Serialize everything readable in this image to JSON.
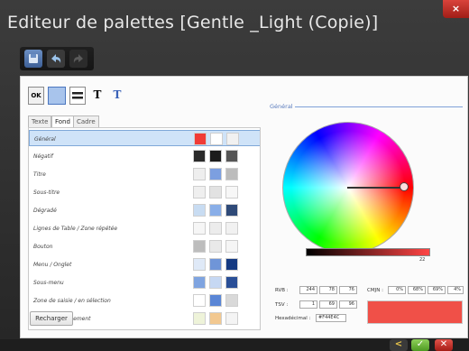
{
  "window": {
    "title": "Editeur de palettes [Gentle _Light (Copie)]",
    "close": "×"
  },
  "toolbar": {
    "icons": [
      "save-icon",
      "undo-icon",
      "redo-icon"
    ]
  },
  "mini_toolbar": {
    "ok": "OK",
    "t1": "T",
    "t2": "T"
  },
  "tabs": [
    "Texte",
    "Fond",
    "Cadre"
  ],
  "active_tab": "Fond",
  "rows": [
    {
      "label": "Général",
      "colors": [
        "#f03b36",
        "#ffffff",
        "#f1f1f1"
      ],
      "selected": true
    },
    {
      "label": "Négatif",
      "colors": [
        "#2a2a2a",
        "#1c1c1c",
        "#555555"
      ]
    },
    {
      "label": "Titre",
      "colors": [
        "#eeeeee",
        "#7c9fe0",
        "#bcbcbc"
      ]
    },
    {
      "label": "Sous-titre",
      "colors": [
        "#efefef",
        "#e2e2e2",
        "#f7f7f7"
      ]
    },
    {
      "label": "Dégradé",
      "colors": [
        "#c8dcf2",
        "#89aee8",
        "#2f4a78"
      ]
    },
    {
      "label": "Lignes de Table / Zone répétée",
      "colors": [
        "#f6f6f6",
        "#ececec",
        "#f1f1f1"
      ]
    },
    {
      "label": "Bouton",
      "colors": [
        "#bdbdbd",
        "#e9e9e9",
        "#f5f5f5"
      ]
    },
    {
      "label": "Menu / Onglet",
      "colors": [
        "#dfe9f7",
        "#6f95d8",
        "#153a82"
      ]
    },
    {
      "label": "Sous-menu",
      "colors": [
        "#7fa4e0",
        "#c6d8f3",
        "#2a4f97"
      ]
    },
    {
      "label": "Zone de saisie / en sélection",
      "colors": [
        "#ffffff",
        "#5a86d6",
        "#d9d9d9"
      ]
    },
    {
      "label": "Note / Avertissement",
      "colors": [
        "#eef3d9",
        "#f2c890",
        "#f4f4f4"
      ]
    }
  ],
  "reload_button": "Recharger",
  "section_title": "Général",
  "brightness_value": "22",
  "rvb": {
    "label": "RVB :",
    "values": [
      "244",
      "78",
      "76"
    ]
  },
  "cmjn": {
    "label": "CMJN :",
    "values": [
      "0%",
      "68%",
      "69%",
      "4%"
    ]
  },
  "tsv": {
    "label": "TSV :",
    "values": [
      "1",
      "69",
      "96"
    ]
  },
  "hex": {
    "label": "Hexadécimal :",
    "value": "#F44E4C"
  },
  "preview_color": "#f05048",
  "bottom_buttons": [
    "back-icon",
    "ok-icon",
    "cancel-icon"
  ]
}
